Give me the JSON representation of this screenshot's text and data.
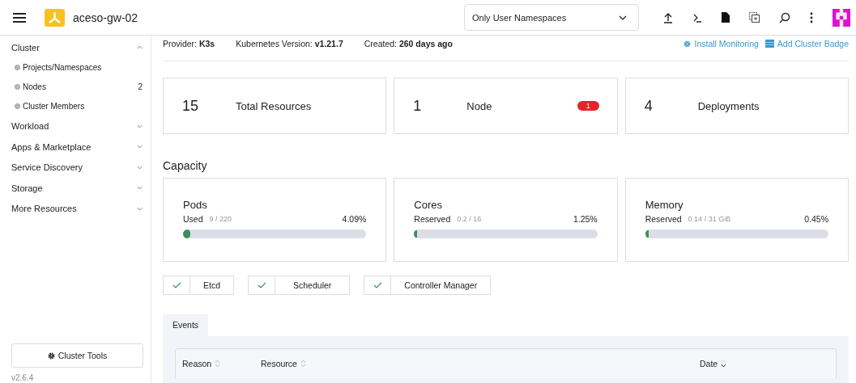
{
  "header": {
    "title": "aceso-gw-02",
    "namespace_filter": "Only User Namespaces"
  },
  "sidebar": {
    "items": [
      {
        "label": "Cluster",
        "expanded": true,
        "children": [
          {
            "label": "Projects/Namespaces"
          },
          {
            "label": "Nodes",
            "count": "2"
          },
          {
            "label": "Cluster Members"
          }
        ]
      },
      {
        "label": "Workload",
        "expanded": false
      },
      {
        "label": "Apps & Marketplace",
        "expanded": false
      },
      {
        "label": "Service Discovery",
        "expanded": false
      },
      {
        "label": "Storage",
        "expanded": false
      },
      {
        "label": "More Resources",
        "expanded": false
      }
    ],
    "tools_button": "Cluster Tools",
    "version": "v2.6.4"
  },
  "info": {
    "facts": [
      "Provider: **K3s**",
      "Kubernetes Version: **v1.21.7**",
      "Created: **260 days ago**"
    ],
    "links": [
      {
        "kind": "gear",
        "label": "Install Monitoring"
      },
      {
        "kind": "badge",
        "label": "Add Cluster Badge"
      }
    ]
  },
  "summary": [
    {
      "count": "15",
      "name": "Total Resources"
    },
    {
      "count": "1",
      "name": "Node",
      "badge": "1"
    },
    {
      "count": "4",
      "name": "Deployments"
    }
  ],
  "capacity": {
    "title": "Capacity",
    "gauges": [
      {
        "title": "Pods",
        "label": "Used",
        "detail": "9 / 220",
        "percent": "4.09%",
        "level": 0.0409
      },
      {
        "title": "Cores",
        "label": "Reserved",
        "detail": "0.2 / 16",
        "percent": "1.25%",
        "level": 0.0125
      },
      {
        "title": "Memory",
        "label": "Reserved",
        "detail": "0.14 / 31 GiB",
        "percent": "0.45%",
        "level": 0.0045
      }
    ]
  },
  "components": [
    {
      "label": "Etcd",
      "healthy": true
    },
    {
      "label": "Scheduler",
      "healthy": true
    },
    {
      "label": "Controller Manager",
      "healthy": true
    }
  ],
  "events": {
    "tabs": [
      {
        "label": "Events",
        "selected": true
      }
    ],
    "columns": [
      {
        "label": "Reason",
        "sorted": false
      },
      {
        "label": "Resource",
        "sorted": false
      },
      {
        "label": "Date",
        "sorted": true
      }
    ]
  }
}
